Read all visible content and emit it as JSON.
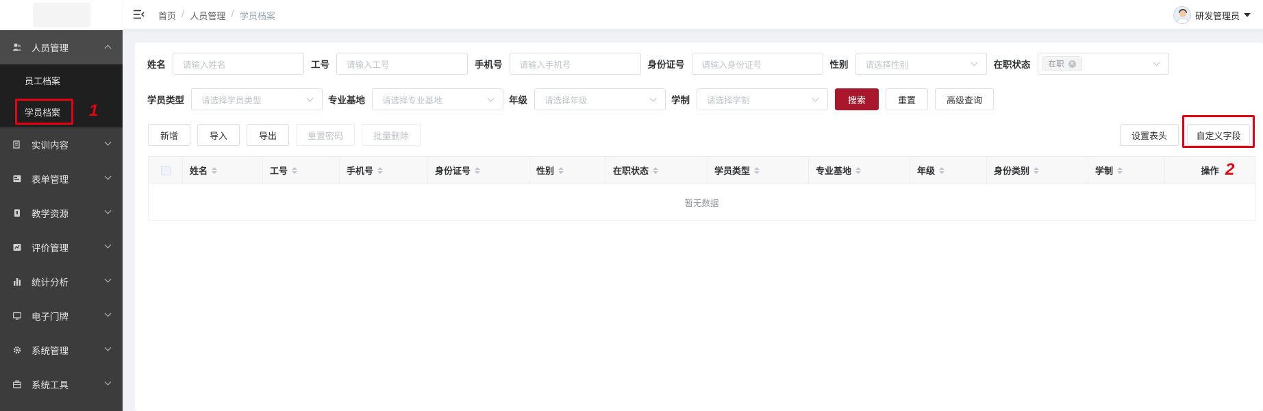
{
  "header": {
    "breadcrumb": [
      "首页",
      "人员管理",
      "学员档案"
    ],
    "user_name": "研发管理员"
  },
  "sidebar": {
    "items": [
      {
        "label": "人员管理",
        "icon": "users-icon",
        "open": true
      },
      {
        "label": "实训内容",
        "icon": "training-icon"
      },
      {
        "label": "表单管理",
        "icon": "form-icon"
      },
      {
        "label": "教学资源",
        "icon": "book-icon"
      },
      {
        "label": "评价管理",
        "icon": "evaluation-icon"
      },
      {
        "label": "统计分析",
        "icon": "bar-chart-icon"
      },
      {
        "label": "电子门牌",
        "icon": "monitor-icon"
      },
      {
        "label": "系统管理",
        "icon": "gear-icon"
      },
      {
        "label": "系统工具",
        "icon": "toolbox-icon"
      }
    ],
    "submenu": [
      {
        "label": "员工档案"
      },
      {
        "label": "学员档案",
        "active": true
      }
    ]
  },
  "annotations": {
    "one": "1",
    "two": "2"
  },
  "filters": {
    "name_label": "姓名",
    "name_placeholder": "请输入姓名",
    "id_label": "工号",
    "id_placeholder": "请输入工号",
    "phone_label": "手机号",
    "phone_placeholder": "请输入手机号",
    "idcard_label": "身份证号",
    "idcard_placeholder": "请输入身份证号",
    "gender_label": "性别",
    "gender_placeholder": "请选择性别",
    "status_label": "在职状态",
    "status_tag": "在职",
    "type_label": "学员类型",
    "type_placeholder": "请选择学员类型",
    "base_label": "专业基地",
    "base_placeholder": "请选择专业基地",
    "grade_label": "年级",
    "grade_placeholder": "请选择年级",
    "system_label": "学制",
    "system_placeholder": "请选择学制"
  },
  "buttons": {
    "search": "搜索",
    "reset": "重置",
    "advanced": "高级查询",
    "add": "新增",
    "import": "导入",
    "export": "导出",
    "reset_password": "重置密码",
    "batch_delete": "批量删除",
    "set_header": "设置表头",
    "custom_fields": "自定义字段"
  },
  "table": {
    "columns": [
      "姓名",
      "工号",
      "手机号",
      "身份证号",
      "性别",
      "在职状态",
      "学员类型",
      "专业基地",
      "年级",
      "身份类别",
      "学制",
      "操作"
    ],
    "empty_text": "暂无数据"
  },
  "colors": {
    "primary": "#a8172b",
    "sidebar": "#3c3c3c",
    "highlight": "#e60012"
  }
}
